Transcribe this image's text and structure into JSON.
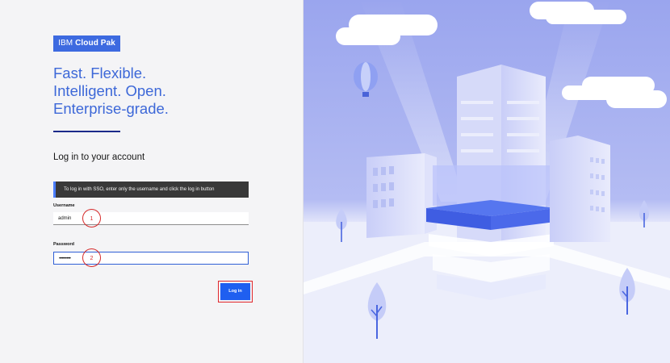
{
  "logo": {
    "prefix": "IBM",
    "product": "Cloud Pak"
  },
  "tagline": [
    "Fast. Flexible.",
    "Intelligent. Open.",
    "Enterprise-grade."
  ],
  "login": {
    "heading": "Log in to your account",
    "sso_message": "To log in with SSO, enter only the username and click the log in button",
    "username_label": "Username",
    "username_value": "admin",
    "password_label": "Password",
    "password_value": "•••••••••",
    "button_label": "Log in"
  },
  "annotations": {
    "marker_1": "1",
    "marker_2": "2"
  },
  "colors": {
    "brand_blue": "#3d6ae0",
    "button_blue": "#1f5ff0",
    "highlight_red": "#e0262c",
    "notification_bg": "#393939"
  }
}
